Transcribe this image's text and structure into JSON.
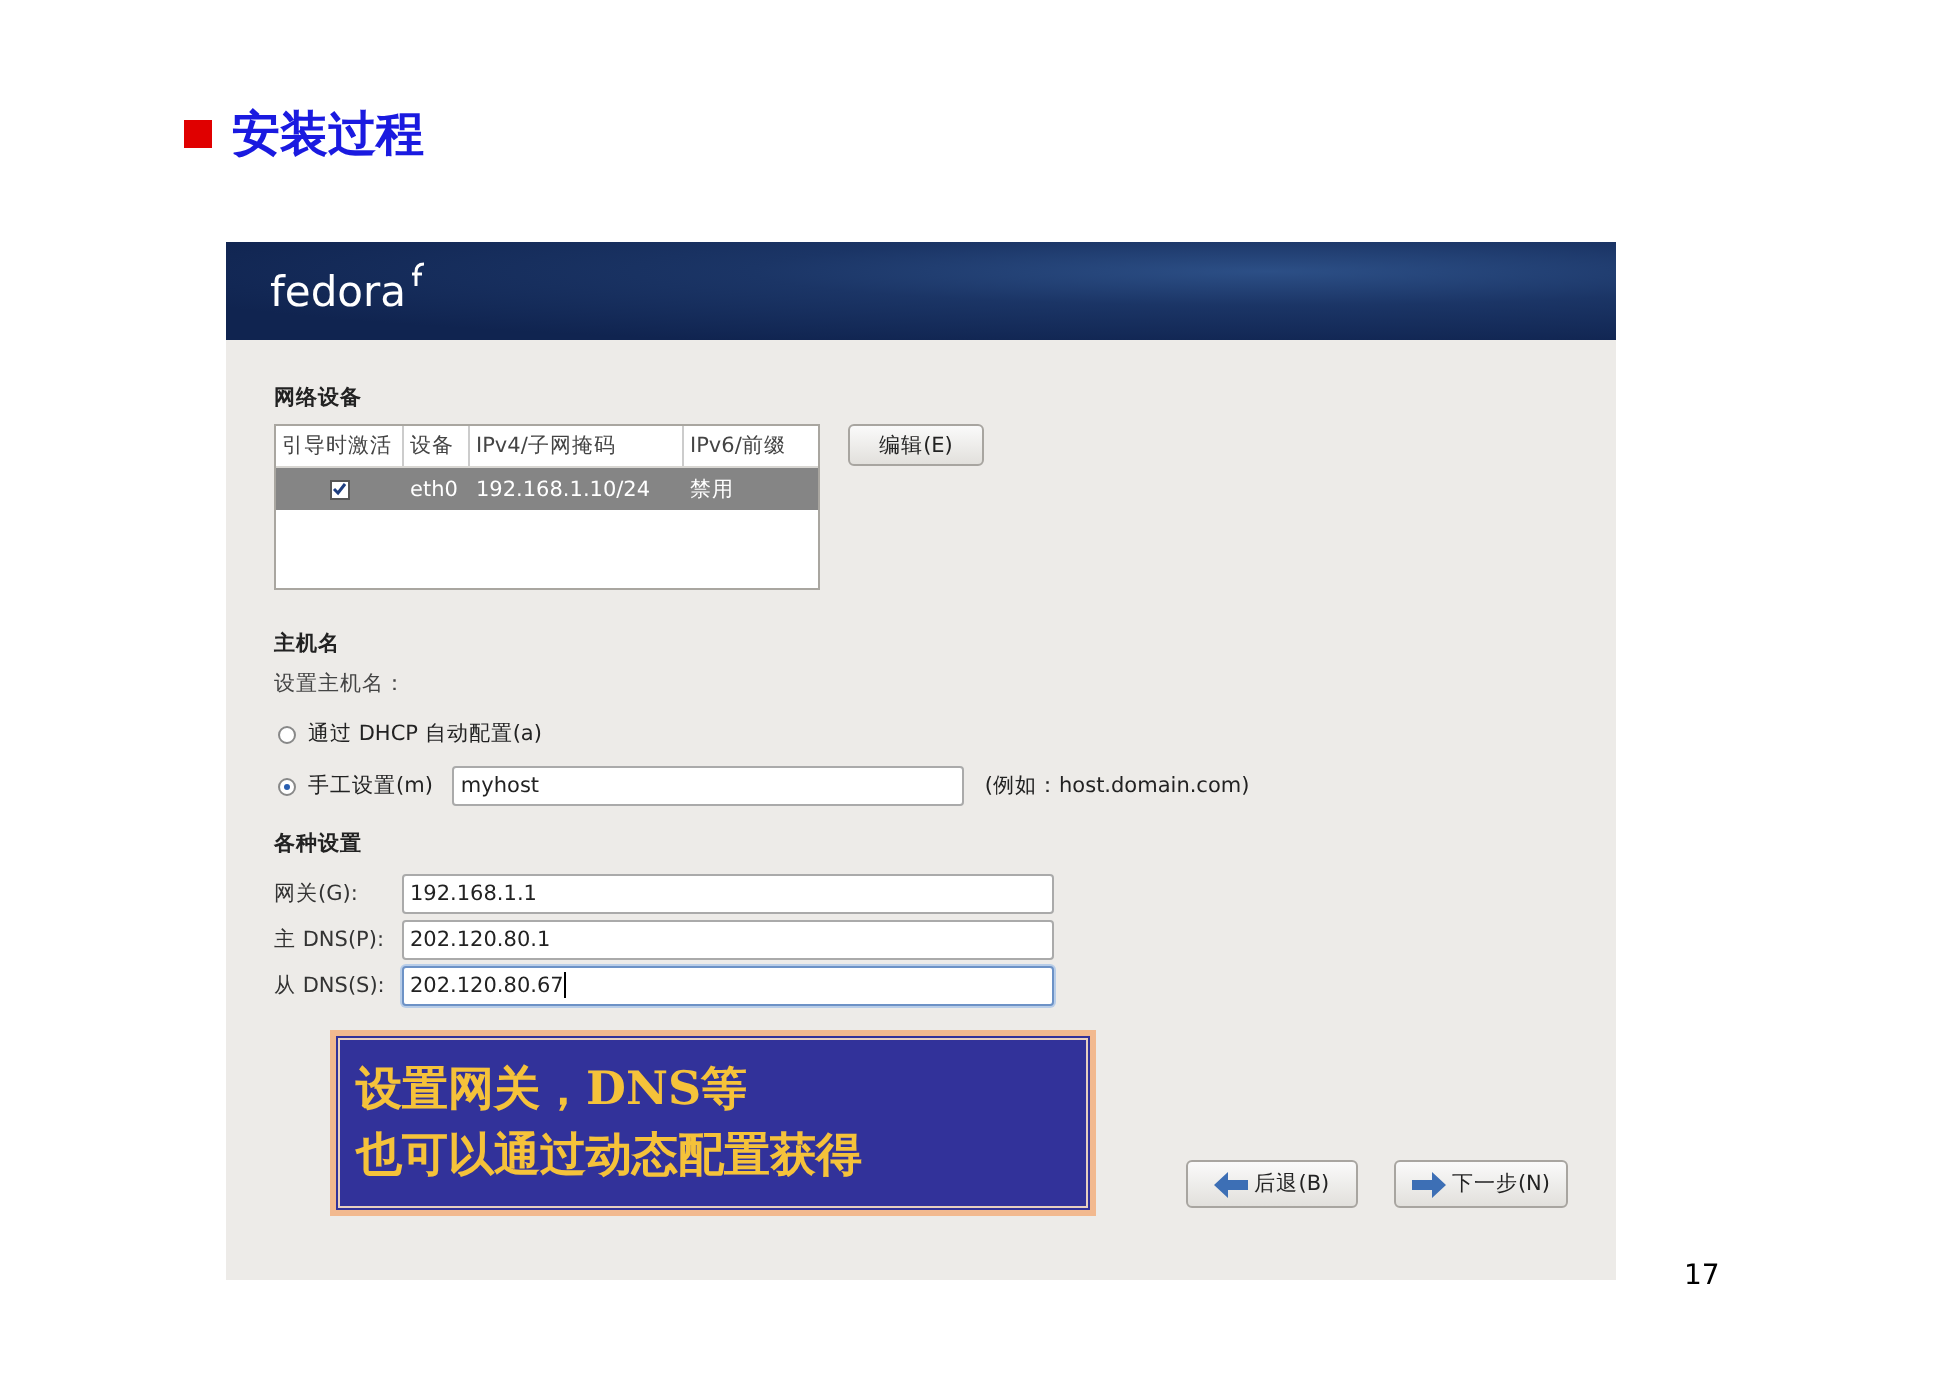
{
  "slide": {
    "title": "安装过程",
    "page_number": "17"
  },
  "installer": {
    "logo": "fedora",
    "network_devices": {
      "heading": "网络设备",
      "columns": [
        "引导时激活",
        "设备",
        "IPv4/子网掩码",
        "IPv6/前缀"
      ],
      "rows": [
        {
          "active_on_boot": true,
          "device": "eth0",
          "ipv4": "192.168.1.10/24",
          "ipv6": "禁用",
          "selected": true
        }
      ],
      "edit_button": "编辑(E)"
    },
    "hostname": {
      "heading": "主机名",
      "prompt": "设置主机名：",
      "options": [
        {
          "label": "通过 DHCP 自动配置(a)",
          "selected": false
        },
        {
          "label": "手工设置(m)",
          "selected": true
        }
      ],
      "value": "myhost",
      "example": "(例如：host.domain.com)"
    },
    "misc": {
      "heading": "各种设置",
      "fields": [
        {
          "label": "网关(G):",
          "value": "192.168.1.1",
          "focused": false
        },
        {
          "label": "主 DNS(P):",
          "value": "202.120.80.1",
          "focused": false
        },
        {
          "label": "从 DNS(S):",
          "value": "202.120.80.67",
          "focused": true
        }
      ]
    },
    "buttons": [
      {
        "label": "后退(B)",
        "kind": "back"
      },
      {
        "label": "下一步(N)",
        "kind": "next"
      }
    ]
  },
  "callout": {
    "lines": [
      "设置网关，DNS等",
      "也可以通过动态配置获得"
    ]
  }
}
